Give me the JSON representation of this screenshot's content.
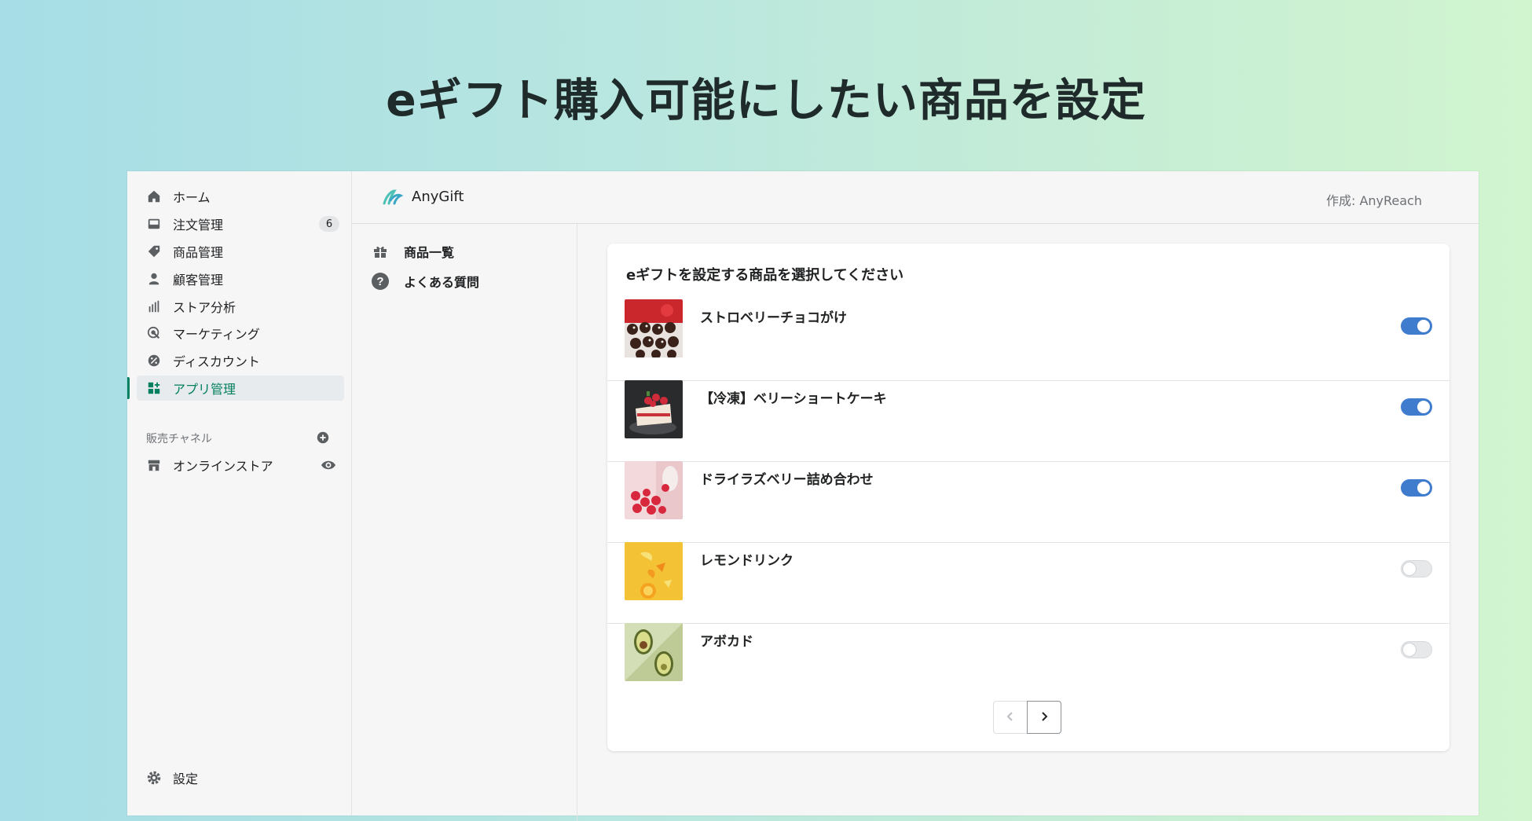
{
  "headline": "eギフト購入可能にしたい商品を設定",
  "sidebar": {
    "items": [
      {
        "label": "ホーム",
        "icon": "home-icon"
      },
      {
        "label": "注文管理",
        "icon": "inbox-icon",
        "badge": "6"
      },
      {
        "label": "商品管理",
        "icon": "tag-icon"
      },
      {
        "label": "顧客管理",
        "icon": "person-icon"
      },
      {
        "label": "ストア分析",
        "icon": "bar-chart-icon"
      },
      {
        "label": "マーケティング",
        "icon": "target-icon"
      },
      {
        "label": "ディスカウント",
        "icon": "discount-icon"
      },
      {
        "label": "アプリ管理",
        "icon": "apps-icon",
        "active": true
      }
    ],
    "sales_channels_label": "販売チャネル",
    "channel": {
      "label": "オンラインストア",
      "icon": "store-icon"
    },
    "settings_label": "設定"
  },
  "topbar": {
    "app_name": "AnyGift",
    "author": "作成: AnyReach"
  },
  "subnav": {
    "items": [
      {
        "label": "商品一覧",
        "icon": "gift-icon"
      },
      {
        "label": "よくある質問",
        "icon": "question-icon"
      }
    ]
  },
  "card": {
    "title": "eギフトを設定する商品を選択してください",
    "products": [
      {
        "name": "ストロベリーチョコがけ",
        "enabled": true
      },
      {
        "name": "【冷凍】ベリーショートケーキ",
        "enabled": true
      },
      {
        "name": "ドライラズベリー詰め合わせ",
        "enabled": true
      },
      {
        "name": "レモンドリンク",
        "enabled": false
      },
      {
        "name": "アボカド",
        "enabled": false
      }
    ]
  },
  "colors": {
    "accent": "#008060",
    "toggle_on": "#3f7ccd"
  }
}
